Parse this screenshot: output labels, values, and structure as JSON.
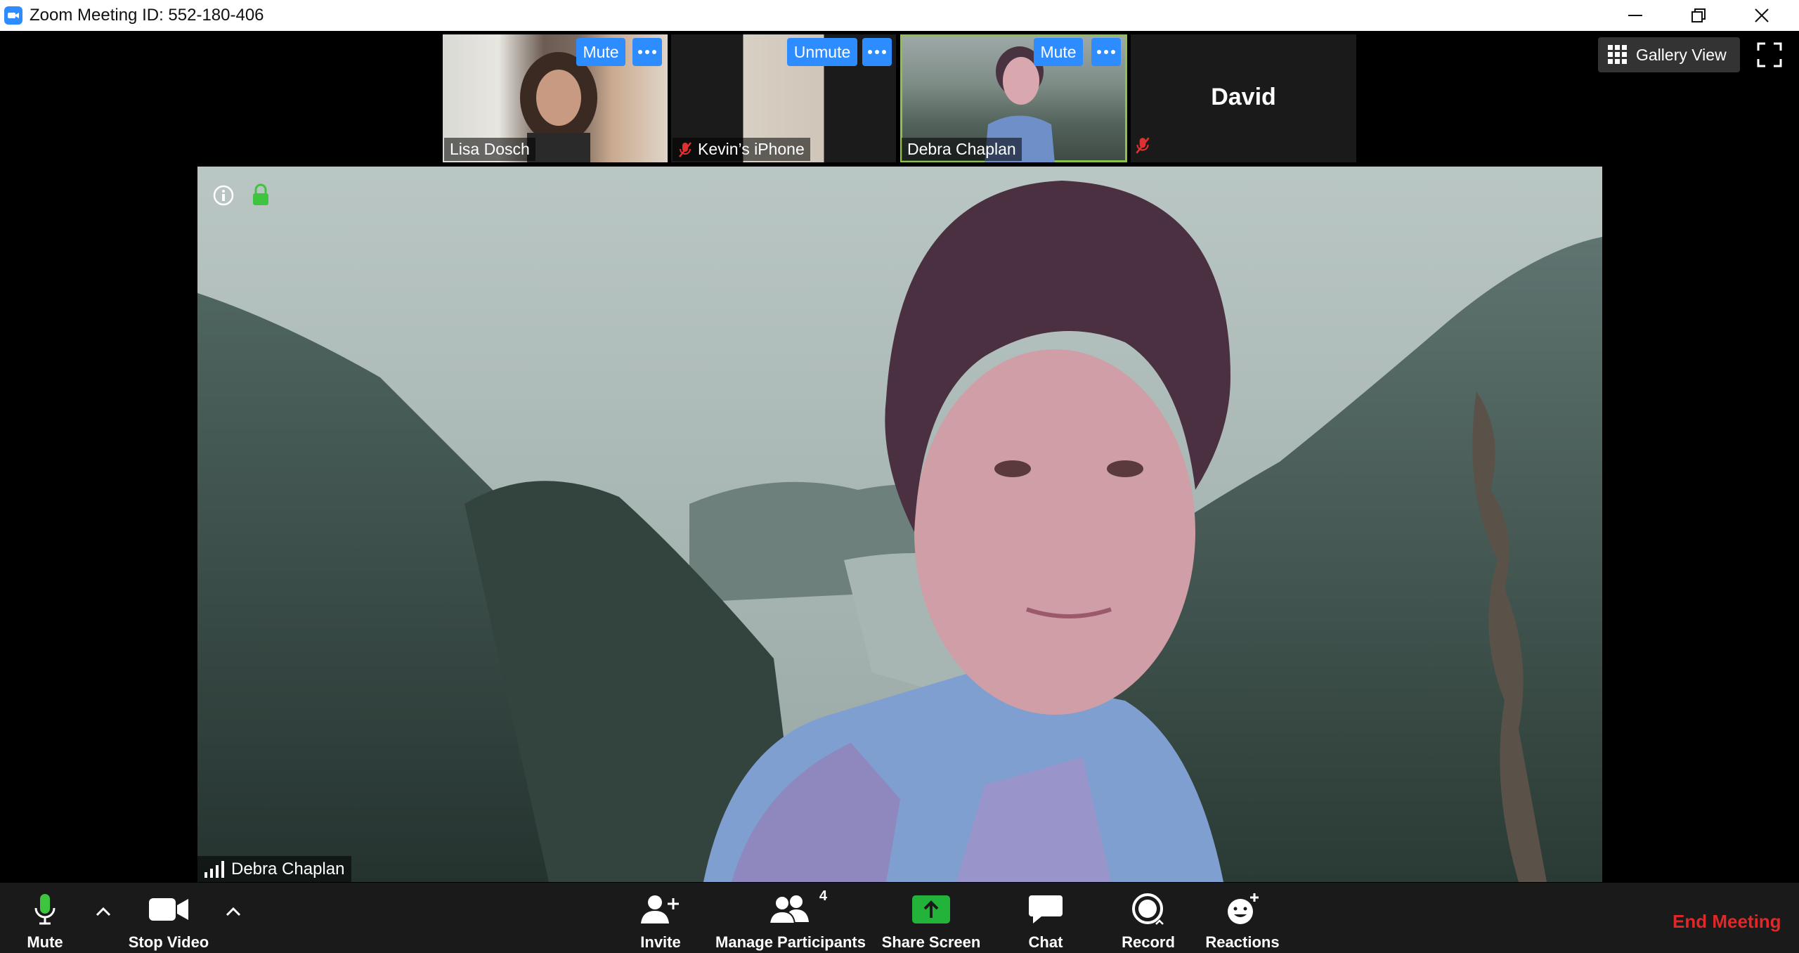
{
  "window": {
    "title": "Zoom Meeting ID: 552-180-406"
  },
  "thumbnails": [
    {
      "name": "Lisa Dosch",
      "button": "Mute",
      "muted": false
    },
    {
      "name": "Kevin’s iPhone",
      "button": "Unmute",
      "muted": true
    },
    {
      "name": "Debra Chaplan",
      "button": "Mute",
      "muted": false,
      "active": true
    },
    {
      "name": "David",
      "muted": true
    }
  ],
  "view": {
    "gallery_label": "Gallery View"
  },
  "main": {
    "speaker_name": "Debra Chaplan"
  },
  "toolbar": {
    "mute_label": "Mute",
    "video_label": "Stop Video",
    "invite_label": "Invite",
    "participants_label": "Manage Participants",
    "participants_count": "4",
    "share_label": "Share Screen",
    "chat_label": "Chat",
    "record_label": "Record",
    "reactions_label": "Reactions",
    "end_label": "End Meeting"
  },
  "colors": {
    "accent": "#2d8cff",
    "share_green": "#24b33a",
    "end_red": "#e02828",
    "active_border": "#8bc34a"
  }
}
